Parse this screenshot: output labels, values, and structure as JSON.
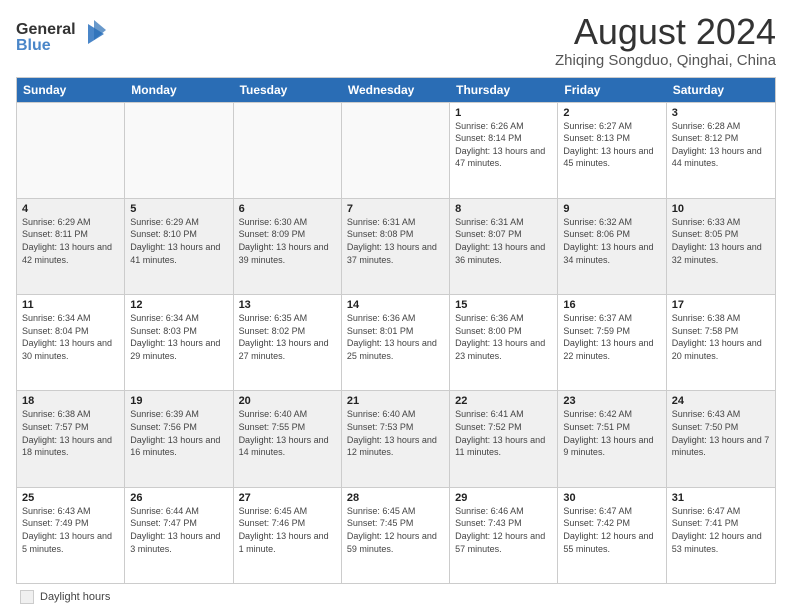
{
  "header": {
    "logo_line1": "General",
    "logo_line2": "Blue",
    "month_year": "August 2024",
    "location": "Zhiqing Songduo, Qinghai, China"
  },
  "day_headers": [
    "Sunday",
    "Monday",
    "Tuesday",
    "Wednesday",
    "Thursday",
    "Friday",
    "Saturday"
  ],
  "weeks": [
    [
      {
        "num": "",
        "info": "",
        "empty": true
      },
      {
        "num": "",
        "info": "",
        "empty": true
      },
      {
        "num": "",
        "info": "",
        "empty": true
      },
      {
        "num": "",
        "info": "",
        "empty": true
      },
      {
        "num": "1",
        "info": "Sunrise: 6:26 AM\nSunset: 8:14 PM\nDaylight: 13 hours\nand 47 minutes.",
        "empty": false
      },
      {
        "num": "2",
        "info": "Sunrise: 6:27 AM\nSunset: 8:13 PM\nDaylight: 13 hours\nand 45 minutes.",
        "empty": false
      },
      {
        "num": "3",
        "info": "Sunrise: 6:28 AM\nSunset: 8:12 PM\nDaylight: 13 hours\nand 44 minutes.",
        "empty": false
      }
    ],
    [
      {
        "num": "4",
        "info": "Sunrise: 6:29 AM\nSunset: 8:11 PM\nDaylight: 13 hours\nand 42 minutes.",
        "empty": false
      },
      {
        "num": "5",
        "info": "Sunrise: 6:29 AM\nSunset: 8:10 PM\nDaylight: 13 hours\nand 41 minutes.",
        "empty": false
      },
      {
        "num": "6",
        "info": "Sunrise: 6:30 AM\nSunset: 8:09 PM\nDaylight: 13 hours\nand 39 minutes.",
        "empty": false
      },
      {
        "num": "7",
        "info": "Sunrise: 6:31 AM\nSunset: 8:08 PM\nDaylight: 13 hours\nand 37 minutes.",
        "empty": false
      },
      {
        "num": "8",
        "info": "Sunrise: 6:31 AM\nSunset: 8:07 PM\nDaylight: 13 hours\nand 36 minutes.",
        "empty": false
      },
      {
        "num": "9",
        "info": "Sunrise: 6:32 AM\nSunset: 8:06 PM\nDaylight: 13 hours\nand 34 minutes.",
        "empty": false
      },
      {
        "num": "10",
        "info": "Sunrise: 6:33 AM\nSunset: 8:05 PM\nDaylight: 13 hours\nand 32 minutes.",
        "empty": false
      }
    ],
    [
      {
        "num": "11",
        "info": "Sunrise: 6:34 AM\nSunset: 8:04 PM\nDaylight: 13 hours\nand 30 minutes.",
        "empty": false
      },
      {
        "num": "12",
        "info": "Sunrise: 6:34 AM\nSunset: 8:03 PM\nDaylight: 13 hours\nand 29 minutes.",
        "empty": false
      },
      {
        "num": "13",
        "info": "Sunrise: 6:35 AM\nSunset: 8:02 PM\nDaylight: 13 hours\nand 27 minutes.",
        "empty": false
      },
      {
        "num": "14",
        "info": "Sunrise: 6:36 AM\nSunset: 8:01 PM\nDaylight: 13 hours\nand 25 minutes.",
        "empty": false
      },
      {
        "num": "15",
        "info": "Sunrise: 6:36 AM\nSunset: 8:00 PM\nDaylight: 13 hours\nand 23 minutes.",
        "empty": false
      },
      {
        "num": "16",
        "info": "Sunrise: 6:37 AM\nSunset: 7:59 PM\nDaylight: 13 hours\nand 22 minutes.",
        "empty": false
      },
      {
        "num": "17",
        "info": "Sunrise: 6:38 AM\nSunset: 7:58 PM\nDaylight: 13 hours\nand 20 minutes.",
        "empty": false
      }
    ],
    [
      {
        "num": "18",
        "info": "Sunrise: 6:38 AM\nSunset: 7:57 PM\nDaylight: 13 hours\nand 18 minutes.",
        "empty": false
      },
      {
        "num": "19",
        "info": "Sunrise: 6:39 AM\nSunset: 7:56 PM\nDaylight: 13 hours\nand 16 minutes.",
        "empty": false
      },
      {
        "num": "20",
        "info": "Sunrise: 6:40 AM\nSunset: 7:55 PM\nDaylight: 13 hours\nand 14 minutes.",
        "empty": false
      },
      {
        "num": "21",
        "info": "Sunrise: 6:40 AM\nSunset: 7:53 PM\nDaylight: 13 hours\nand 12 minutes.",
        "empty": false
      },
      {
        "num": "22",
        "info": "Sunrise: 6:41 AM\nSunset: 7:52 PM\nDaylight: 13 hours\nand 11 minutes.",
        "empty": false
      },
      {
        "num": "23",
        "info": "Sunrise: 6:42 AM\nSunset: 7:51 PM\nDaylight: 13 hours\nand 9 minutes.",
        "empty": false
      },
      {
        "num": "24",
        "info": "Sunrise: 6:43 AM\nSunset: 7:50 PM\nDaylight: 13 hours\nand 7 minutes.",
        "empty": false
      }
    ],
    [
      {
        "num": "25",
        "info": "Sunrise: 6:43 AM\nSunset: 7:49 PM\nDaylight: 13 hours\nand 5 minutes.",
        "empty": false
      },
      {
        "num": "26",
        "info": "Sunrise: 6:44 AM\nSunset: 7:47 PM\nDaylight: 13 hours\nand 3 minutes.",
        "empty": false
      },
      {
        "num": "27",
        "info": "Sunrise: 6:45 AM\nSunset: 7:46 PM\nDaylight: 13 hours\nand 1 minute.",
        "empty": false
      },
      {
        "num": "28",
        "info": "Sunrise: 6:45 AM\nSunset: 7:45 PM\nDaylight: 12 hours\nand 59 minutes.",
        "empty": false
      },
      {
        "num": "29",
        "info": "Sunrise: 6:46 AM\nSunset: 7:43 PM\nDaylight: 12 hours\nand 57 minutes.",
        "empty": false
      },
      {
        "num": "30",
        "info": "Sunrise: 6:47 AM\nSunset: 7:42 PM\nDaylight: 12 hours\nand 55 minutes.",
        "empty": false
      },
      {
        "num": "31",
        "info": "Sunrise: 6:47 AM\nSunset: 7:41 PM\nDaylight: 12 hours\nand 53 minutes.",
        "empty": false
      }
    ]
  ],
  "footer": {
    "legend_label": "Daylight hours"
  }
}
